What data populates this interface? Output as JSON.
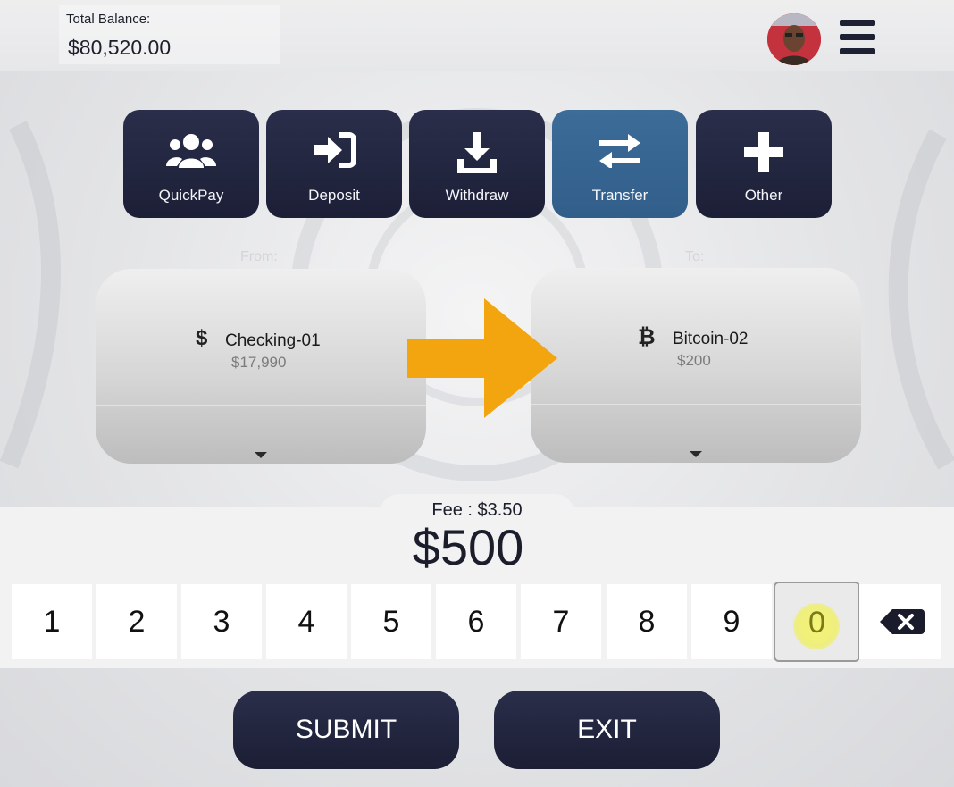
{
  "header": {
    "balance_label": "Total Balance:",
    "balance_value": "$80,520.00",
    "avatar_icon": "user-avatar",
    "menu_icon": "hamburger-menu-icon"
  },
  "actions": [
    {
      "label": "QuickPay",
      "icon": "users-icon",
      "active": false
    },
    {
      "label": "Deposit",
      "icon": "sign-in-icon",
      "active": false
    },
    {
      "label": "Withdraw",
      "icon": "download-icon",
      "active": false
    },
    {
      "label": "Transfer",
      "icon": "exchange-arrows-icon",
      "active": true
    },
    {
      "label": "Other",
      "icon": "plus-icon",
      "active": false
    }
  ],
  "transfer": {
    "from_label": "From:",
    "to_label": "To:",
    "from": {
      "icon": "$",
      "name": "Checking-01",
      "balance": "$17,990"
    },
    "to": {
      "icon": "₿",
      "name": "Bitcoin-02",
      "balance": "$200"
    },
    "fee": "Fee : $3.50",
    "amount": "$500"
  },
  "keypad": {
    "keys": [
      "1",
      "2",
      "3",
      "4",
      "5",
      "6",
      "7",
      "8",
      "9",
      "0"
    ],
    "pressed_key": "0",
    "backspace_icon": "backspace-icon"
  },
  "buttons": {
    "submit": "SUBMIT",
    "exit": "EXIT"
  },
  "colors": {
    "dark_button": "#1c1f36",
    "active_button": "#3a6894",
    "arrow": "#f3a50f"
  }
}
